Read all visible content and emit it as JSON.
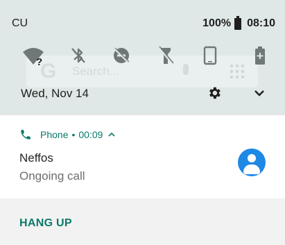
{
  "status_bar": {
    "carrier": "CU",
    "battery_percent": "100%",
    "time": "08:10"
  },
  "quick_settings": {
    "tiles": [
      {
        "icon": "wifi-question-icon",
        "glyph": "?"
      },
      {
        "icon": "bluetooth-off-icon"
      },
      {
        "icon": "do-not-disturb-off-icon"
      },
      {
        "icon": "flashlight-off-icon"
      },
      {
        "icon": "auto-rotate-icon"
      },
      {
        "icon": "battery-saver-icon"
      }
    ],
    "date": "Wed, Nov 14",
    "search_ghost": {
      "g": "G",
      "placeholder": "Search..."
    }
  },
  "notification": {
    "app": "Phone",
    "elapsed": "00:09",
    "separator": "•",
    "title": "Neffos",
    "text": "Ongoing call",
    "accent_color": "#0a7a6a",
    "avatar_color": "#1e88e5",
    "actions": {
      "hang_up": "HANG UP"
    }
  }
}
